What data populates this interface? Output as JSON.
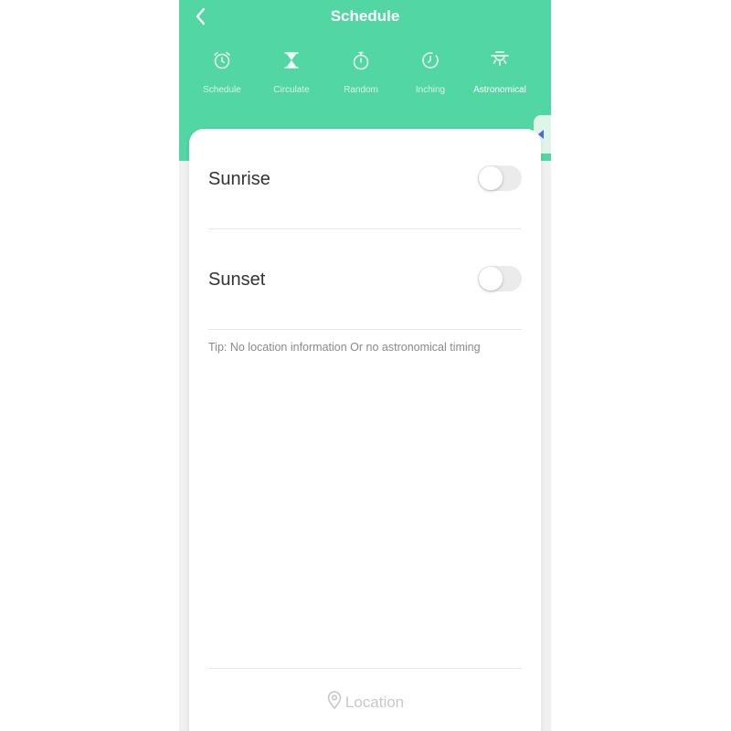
{
  "header": {
    "title": "Schedule",
    "back_icon": "chevron-left-icon",
    "background_color": "#52d6a3"
  },
  "tabs": [
    {
      "label": "Schedule",
      "icon": "alarm-clock-icon",
      "active": false
    },
    {
      "label": "Circulate",
      "icon": "hourglass-icon",
      "active": false
    },
    {
      "label": "Random",
      "icon": "stopwatch-icon",
      "active": false
    },
    {
      "label": "Inching",
      "icon": "timer-icon",
      "active": false
    },
    {
      "label": "Astronomical",
      "icon": "sun-horizon-icon",
      "active": true
    }
  ],
  "settings": {
    "sunrise": {
      "label": "Sunrise",
      "enabled": false
    },
    "sunset": {
      "label": "Sunset",
      "enabled": false
    },
    "tip": "Tip: No location information Or no astronomical timing"
  },
  "footer": {
    "location_label": "Location",
    "location_icon": "location-pin-icon"
  }
}
